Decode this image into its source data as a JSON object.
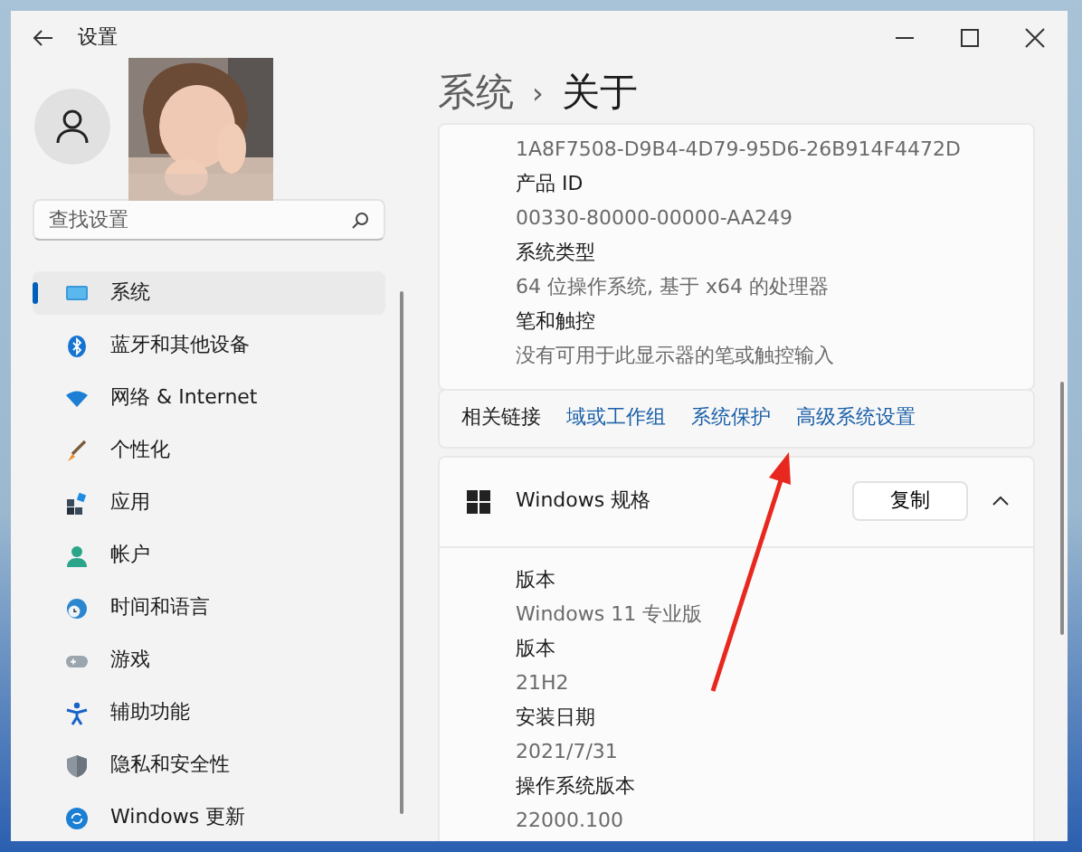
{
  "window": {
    "title": "设置"
  },
  "search": {
    "placeholder": "查找设置"
  },
  "sidebar": {
    "items": [
      {
        "label": "系统",
        "selected": true
      },
      {
        "label": "蓝牙和其他设备",
        "selected": false
      },
      {
        "label": "网络 & Internet",
        "selected": false
      },
      {
        "label": "个性化",
        "selected": false
      },
      {
        "label": "应用",
        "selected": false
      },
      {
        "label": "帐户",
        "selected": false
      },
      {
        "label": "时间和语言",
        "selected": false
      },
      {
        "label": "游戏",
        "selected": false
      },
      {
        "label": "辅助功能",
        "selected": false
      },
      {
        "label": "隐私和安全性",
        "selected": false
      },
      {
        "label": "Windows 更新",
        "selected": false
      }
    ]
  },
  "breadcrumb": {
    "parent": "系统",
    "separator": "›",
    "current": "关于"
  },
  "device_specs": {
    "items": [
      {
        "kind": "value",
        "text": "1A8F7508-D9B4-4D79-95D6-26B914F4472D"
      },
      {
        "kind": "label",
        "text": "产品 ID"
      },
      {
        "kind": "value",
        "text": "00330-80000-00000-AA249"
      },
      {
        "kind": "label",
        "text": "系统类型"
      },
      {
        "kind": "value",
        "text": "64 位操作系统, 基于 x64 的处理器"
      },
      {
        "kind": "label",
        "text": "笔和触控"
      },
      {
        "kind": "value",
        "text": "没有可用于此显示器的笔或触控输入"
      }
    ]
  },
  "related_links": {
    "label": "相关链接",
    "links": [
      "域或工作组",
      "系统保护",
      "高级系统设置"
    ]
  },
  "windows_specs": {
    "title": "Windows 规格",
    "copy_button": "复制",
    "expanded": true,
    "items": [
      {
        "kind": "label",
        "text": "版本"
      },
      {
        "kind": "value",
        "text": "Windows 11 专业版"
      },
      {
        "kind": "label",
        "text": "版本"
      },
      {
        "kind": "value",
        "text": "21H2"
      },
      {
        "kind": "label",
        "text": "安装日期"
      },
      {
        "kind": "value",
        "text": "2021/7/31"
      },
      {
        "kind": "label",
        "text": "操作系统版本"
      },
      {
        "kind": "value",
        "text": "22000.100"
      }
    ]
  }
}
